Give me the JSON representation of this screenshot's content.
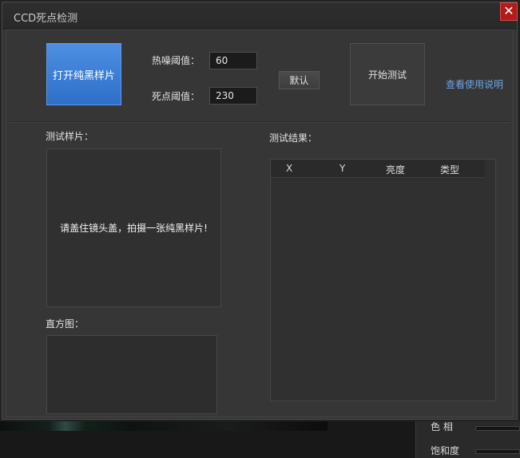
{
  "window": {
    "title": "CCD死点检测",
    "close_glyph": "✕"
  },
  "controls": {
    "open_sample_button": "打开纯黑样片",
    "hot_noise_label": "热噪阈值：",
    "hot_noise_value": "60",
    "dead_pixel_label": "死点阈值：",
    "dead_pixel_value": "230",
    "default_button": "默认",
    "start_test_button": "开始测试",
    "help_link": "查看使用说明"
  },
  "sample_panel": {
    "label": "测试样片：",
    "hint": "请盖住镜头盖，拍摄一张纯黑样片!"
  },
  "histogram_panel": {
    "label": "直方图："
  },
  "results_panel": {
    "label": "测试结果：",
    "columns": [
      "X",
      "Y",
      "亮度",
      "类型"
    ]
  },
  "background_app": {
    "hue_label": "色    相",
    "saturation_label": "饱和度"
  },
  "colors": {
    "accent_blue": "#3a7bd5",
    "close_red": "#b21b17",
    "link_blue": "#6aa6e8",
    "panel_bg": "#353535"
  }
}
